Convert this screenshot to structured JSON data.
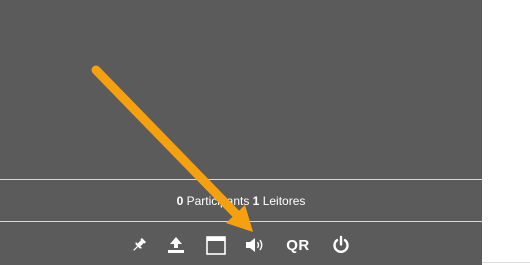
{
  "status": {
    "participants_count": "0",
    "participants_label": "Participants",
    "readers_count": "1",
    "readers_label": "Leitores"
  },
  "toolbar": {
    "buttons": [
      {
        "icon": "pin-icon"
      },
      {
        "icon": "upload-icon"
      },
      {
        "icon": "window-icon"
      },
      {
        "icon": "speaker-icon"
      },
      {
        "icon": "qr-code",
        "label": "QR"
      },
      {
        "icon": "power-icon"
      }
    ]
  },
  "colors": {
    "panel": "#5b5b5b",
    "divider": "#d8d8d8",
    "text": "#ffffff",
    "annotation_arrow": "#f5a10f"
  }
}
